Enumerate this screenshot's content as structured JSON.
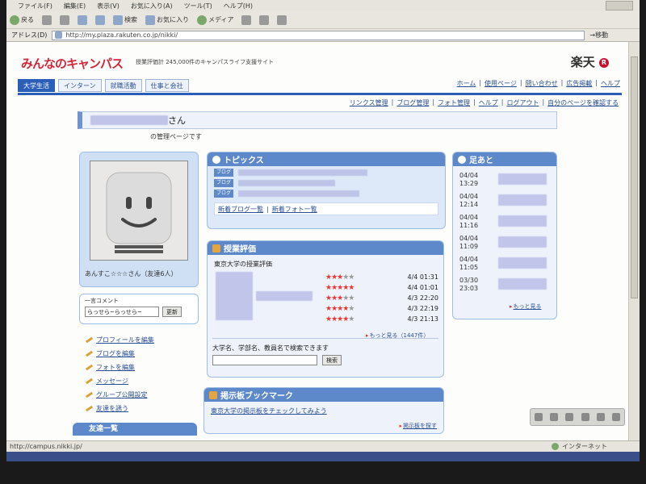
{
  "browser": {
    "menu": [
      "ファイル(F)",
      "編集(E)",
      "表示(V)",
      "お気に入り(A)",
      "ツール(T)",
      "ヘルプ(H)"
    ],
    "toolbar": {
      "back": "戻る",
      "search": "検索",
      "favorites": "お気に入り",
      "media": "メディア"
    },
    "address_label": "アドレス(D)",
    "url": "http://my.plaza.rakuten.co.jp/nikki/",
    "go_label": "移動",
    "status_text": "http://campus.nikki.jp/",
    "zone_text": "インターネット"
  },
  "site": {
    "logo": "みんなのキャンパス",
    "tagline": "授業評価計 245,000件のキャンパスライフ支援サイト",
    "rakuten_text": "楽天",
    "rakuten_mark": "R",
    "tabs": [
      "大学生活",
      "インターン",
      "就職活動",
      "仕事と会社"
    ],
    "top_links": [
      "ホーム",
      "使用ページ",
      "問い合わせ",
      "広告掲載",
      "ヘルプ"
    ],
    "sub_links": [
      "リンクス管理",
      "ブログ管理",
      "フォト管理",
      "ヘルプ",
      "ログアウト",
      "自分のページを確認する"
    ]
  },
  "profile": {
    "name_suffix": "さん",
    "manage_note": "の管理ページです",
    "owner_line": "あんすこ☆☆☆さん（友達6人）",
    "comment_label": "一言コメント",
    "comment_value": "らっせら~らっせら~",
    "update_button": "更新",
    "menu": [
      "プロフィールを編集",
      "ブログを編集",
      "フォトを編集",
      "メッセージ",
      "グループ公開設定",
      "友達を誘う"
    ],
    "friends_heading": "友達一覧"
  },
  "topics": {
    "heading": "トピックス",
    "tags": [
      "ブログ",
      "ブログ",
      "ブログ"
    ],
    "links": [
      "新着ブログ一覧",
      "新着フォト一覧"
    ],
    "separator": "|"
  },
  "ratings": {
    "heading": "授業評価",
    "university": "東京大学の授業評価",
    "rows": [
      {
        "stars": 3,
        "time": "4/4 01:31"
      },
      {
        "stars": 5,
        "time": "4/4 01:01"
      },
      {
        "stars": 3,
        "time": "4/3 22:20"
      },
      {
        "stars": 4,
        "time": "4/3 22:19"
      },
      {
        "stars": 4,
        "time": "4/3 21:13"
      }
    ],
    "more_link": "もっと見る（1447件）",
    "search_label": "大学名、学部名、教員名で検索できます",
    "search_button": "検索"
  },
  "bbs": {
    "heading": "掲示板ブックマーク",
    "text": "東京大学の掲示板をチェックしてみよう",
    "link": "掲示板を探す"
  },
  "footprints": {
    "heading": "足あと",
    "entries": [
      {
        "date": "04/04",
        "time": "13:29"
      },
      {
        "date": "04/04",
        "time": "12:14"
      },
      {
        "date": "04/04",
        "time": "11:16"
      },
      {
        "date": "04/04",
        "time": "11:09"
      },
      {
        "date": "04/04",
        "time": "11:05"
      },
      {
        "date": "03/30",
        "time": "23:03"
      }
    ],
    "more_link": "もっと見る"
  },
  "colors": {
    "accent": "#2b5fb7",
    "logo_red": "#d2283a",
    "panel_head": "#5d88c9",
    "star_red": "#e33333"
  }
}
